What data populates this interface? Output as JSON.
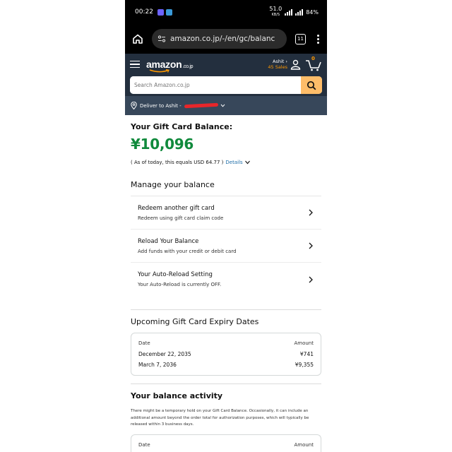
{
  "status_bar": {
    "time": "00:22",
    "net_speed": "51.0",
    "net_unit": "KB/S",
    "battery": "84%"
  },
  "browser": {
    "url": "amazon.co.jp/-/en/gc/balanc",
    "tab_count": "11"
  },
  "header": {
    "logo": "amazon",
    "logo_tld": ".co.jp",
    "account_name": "Ashit ›",
    "account_prime": "45 Sales",
    "cart_count": "0"
  },
  "search": {
    "placeholder": "Search Amazon.co.jp"
  },
  "deliver": {
    "label": "Deliver to Ashit -"
  },
  "gift_card": {
    "title": "Your Gift Card Balance:",
    "balance": "¥10,096",
    "equiv_text": "( As of today, this equals  USD 64.77 )",
    "details_link": "Details"
  },
  "manage": {
    "heading": "Manage your balance",
    "items": [
      {
        "title": "Redeem another gift card",
        "subtitle": "Redeem using gift card claim code"
      },
      {
        "title": "Reload Your Balance",
        "subtitle": "Add funds with your credit or debit card"
      },
      {
        "title": "Your Auto-Reload Setting",
        "subtitle": "Your Auto-Reload is currently OFF."
      }
    ]
  },
  "expiry": {
    "heading": "Upcoming Gift Card Expiry Dates",
    "col_date": "Date",
    "col_amount": "Amount",
    "rows": [
      {
        "date": "December 22, 2035",
        "amount": "¥741"
      },
      {
        "date": "March 7, 2036",
        "amount": "¥9,355"
      }
    ]
  },
  "activity": {
    "heading": "Your balance activity",
    "note": "There might be a temporary hold on your Gift Card Balance. Occasionally, it can include an additional amount beyond the order total for authorization purposes, which will typically be released within 3 business days.",
    "col_date": "Date",
    "col_amount": "Amount"
  },
  "colors": {
    "amazon_dark": "#232f3e",
    "deliver_bar": "#37475a",
    "balance_green": "#108a3c",
    "search_button": "#febd69",
    "link_blue": "#1f6ea9"
  }
}
